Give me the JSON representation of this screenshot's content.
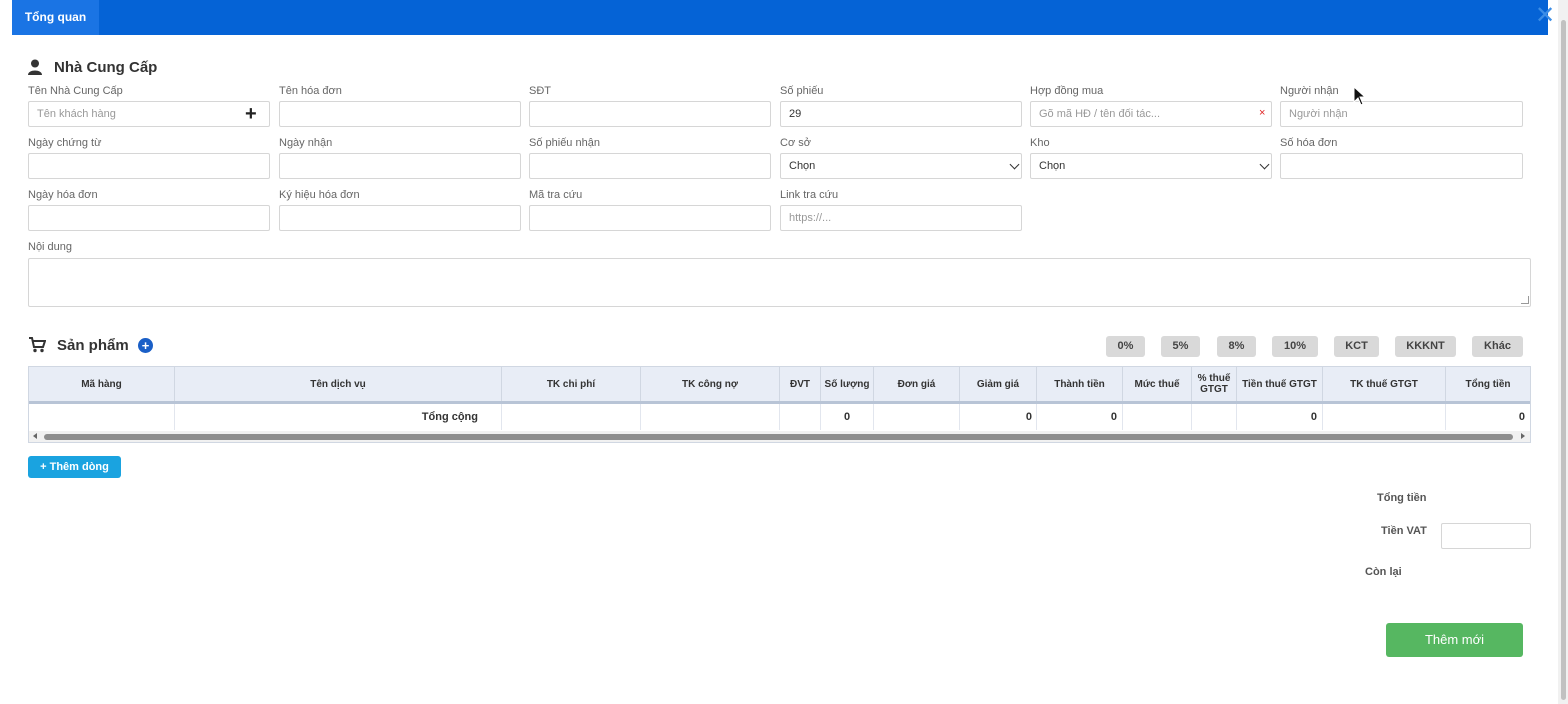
{
  "header": {
    "tab_label": "Tổng quan",
    "close_icon": "close-icon"
  },
  "supplier_section": {
    "title": "Nhà Cung Cấp",
    "icon": "user-icon"
  },
  "fields": {
    "supplier_name": {
      "label": "Tên Nhà Cung Cấp",
      "placeholder": "Tên khách hàng",
      "value": ""
    },
    "invoice_name": {
      "label": "Tên hóa đơn",
      "value": ""
    },
    "phone": {
      "label": "SĐT",
      "value": ""
    },
    "voucher_no": {
      "label": "Số phiếu",
      "value": "29"
    },
    "purchase_contract": {
      "label": "Hợp đồng mua",
      "placeholder": "Gõ mã HĐ / tên đối tác...",
      "clear": "×"
    },
    "receiver": {
      "label": "Người nhận",
      "placeholder": "Người nhận"
    },
    "document_date": {
      "label": "Ngày chứng từ",
      "value": ""
    },
    "received_date": {
      "label": "Ngày nhận",
      "value": ""
    },
    "receipt_no": {
      "label": "Số phiếu nhận",
      "value": ""
    },
    "facility": {
      "label": "Cơ sở",
      "value": "Chọn"
    },
    "warehouse": {
      "label": "Kho",
      "value": "Chọn"
    },
    "invoice_no": {
      "label": "Số hóa đơn",
      "value": ""
    },
    "invoice_date": {
      "label": "Ngày hóa đơn",
      "value": ""
    },
    "invoice_symbol": {
      "label": "Ký hiệu hóa đơn",
      "value": ""
    },
    "lookup_code": {
      "label": "Mã tra cứu",
      "value": ""
    },
    "lookup_link": {
      "label": "Link tra cứu",
      "placeholder": "https://..."
    },
    "content": {
      "label": "Nội dung",
      "value": ""
    }
  },
  "products_section": {
    "title": "Sản phẩm",
    "icon": "cart-icon",
    "add_icon": "+"
  },
  "tax_rates": [
    "0%",
    "5%",
    "8%",
    "10%",
    "KCT",
    "KKKNT",
    "Khác"
  ],
  "table": {
    "columns": [
      "Mã hàng",
      "Tên dịch vụ",
      "TK chi phí",
      "TK công nợ",
      "ĐVT",
      "Số lượng",
      "Đơn giá",
      "Giảm giá",
      "Thành tiền",
      "Mức thuế",
      "% thuế GTGT",
      "Tiền thuế GTGT",
      "TK thuế GTGT",
      "Tổng tiền"
    ],
    "footer": {
      "label": "Tổng cộng",
      "quantity": "0",
      "discount": "0",
      "amount": "0",
      "vat_amount": "0",
      "total": "0"
    }
  },
  "add_row_button": "+ Thêm dòng",
  "summary": {
    "total_label": "Tổng tiền",
    "vat_label": "Tiền VAT",
    "remaining_label": "Còn lại"
  },
  "submit_button": "Thêm mới"
}
